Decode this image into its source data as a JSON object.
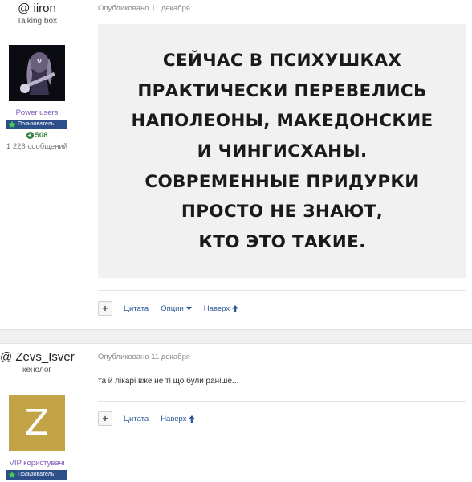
{
  "posts": [
    {
      "author": {
        "username": "@ iiron",
        "title": "Talking box",
        "group": "Power users",
        "badge": "Пользователь",
        "reputation": "508",
        "post_count": "1 228 сообщений"
      },
      "date": "Опубликовано 11 декабря",
      "meme_lines": [
        "СЕЙЧАС В ПСИХУШКАХ",
        "ПРАКТИЧЕСКИ ПЕРЕВЕЛИСЬ",
        "НАПОЛЕОНЫ, МАКЕДОНСКИЕ",
        "И ЧИНГИСХАНЫ.",
        "СОВРЕМЕННЫЕ ПРИДУРКИ",
        "ПРОСТО НЕ ЗНАЮТ,",
        "КТО ЭТО ТАКИЕ."
      ],
      "actions": {
        "add": "+",
        "quote": "Цитата",
        "options": "Опции",
        "top": "Наверх"
      }
    },
    {
      "author": {
        "username": "@ Zevs_Isver",
        "title": "кенолог",
        "avatar_letter": "Z",
        "group": "VIP користувачі",
        "badge": "Пользователь"
      },
      "date": "Опубликовано 11 декабря",
      "text": "та й лікарі вже не ті що були раніше...",
      "actions": {
        "add": "+",
        "quote": "Цитата",
        "top": "Наверх"
      }
    }
  ],
  "colors": {
    "link": "#2d5a98",
    "group_purple": "#7b57b8",
    "badge_bg": "#2c4f8a",
    "rep_green": "#37803a",
    "avatar_z": "#c2a447"
  }
}
